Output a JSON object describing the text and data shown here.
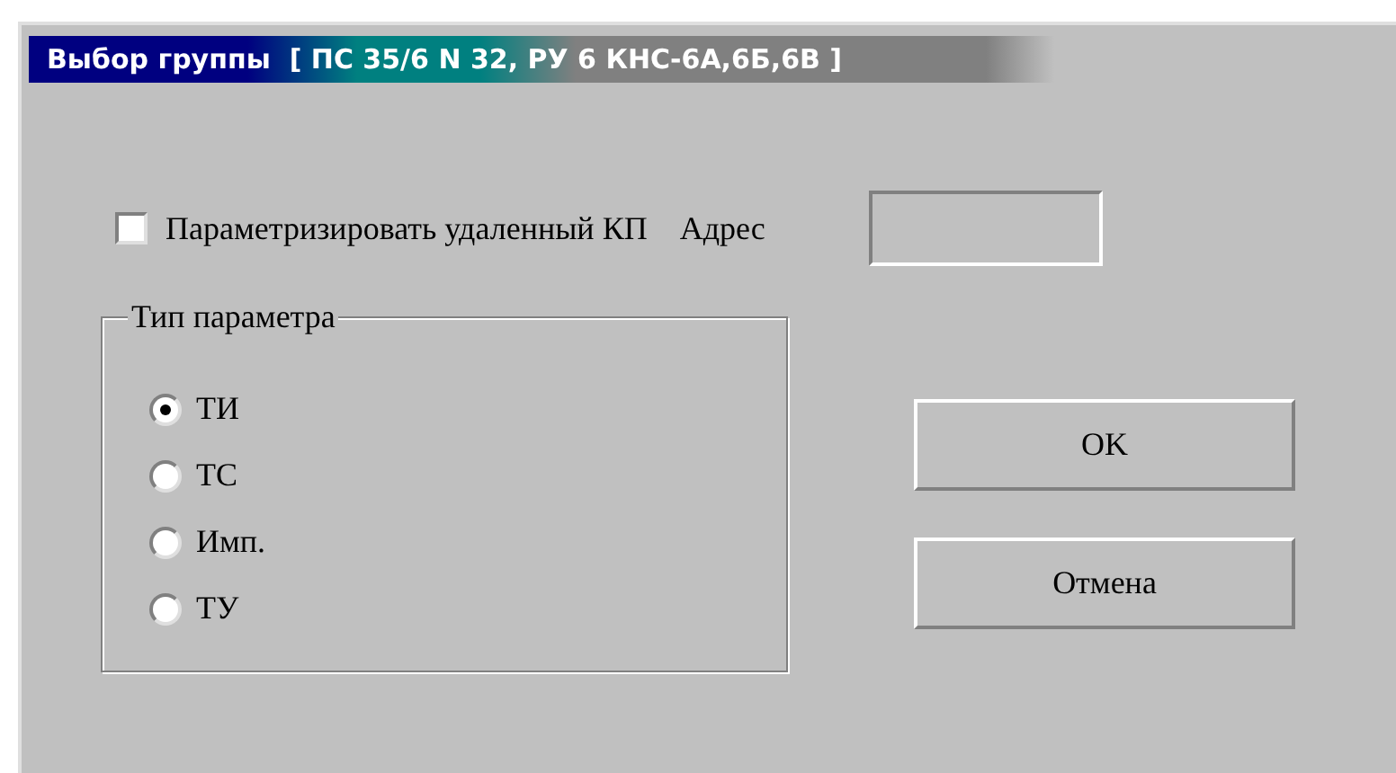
{
  "window": {
    "title": "Выбор группы  [ ПС 35/6 N 32, РУ 6 КНС-6А,6Б,6В ]"
  },
  "remote": {
    "label": "Параметризировать удаленный КП",
    "checked": false
  },
  "address": {
    "label": "Адрес"
  },
  "param_type": {
    "title": "Тип параметра",
    "options": [
      {
        "label": "ТИ",
        "selected": true
      },
      {
        "label": "ТС",
        "selected": false
      },
      {
        "label": "Имп.",
        "selected": false
      },
      {
        "label": "ТУ",
        "selected": false
      }
    ]
  },
  "buttons": [
    "OK",
    "Отмена"
  ]
}
